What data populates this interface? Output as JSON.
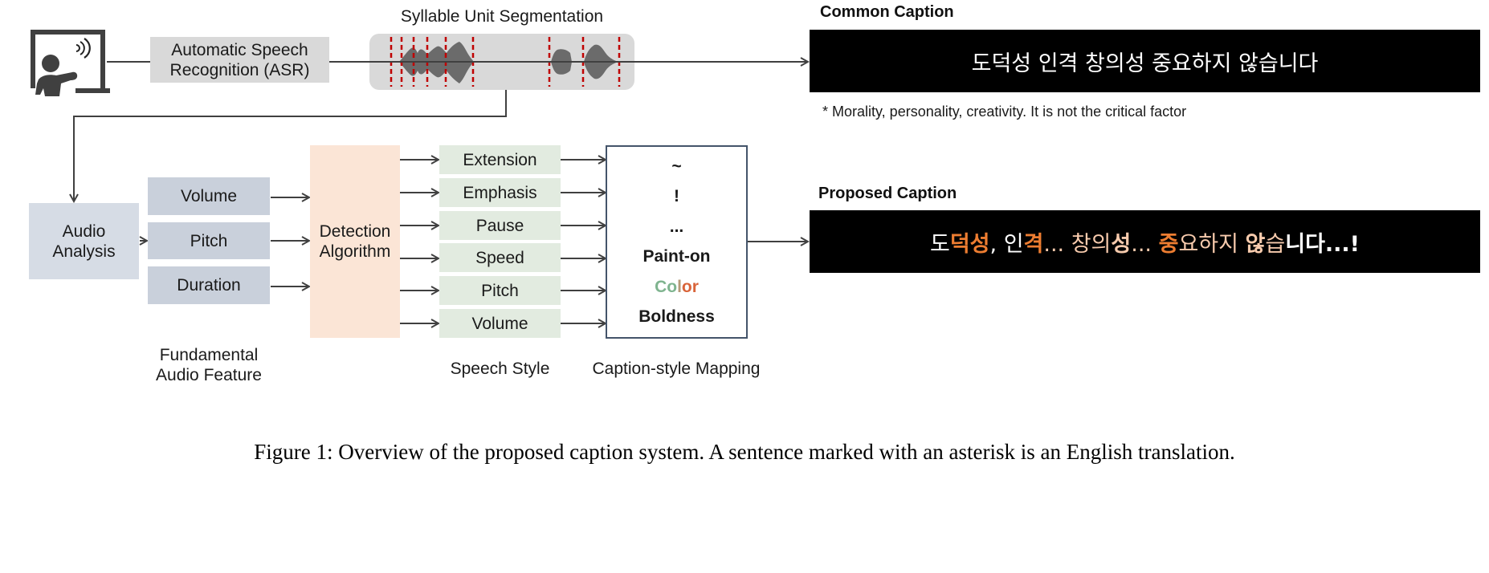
{
  "figure": {
    "caption": "Figure 1: Overview of the proposed caption system. A sentence marked with an asterisk is an English translation."
  },
  "speaker": {
    "icon": "teacher-presenting-speaking-icon"
  },
  "asr": {
    "label_line1": "Automatic Speech",
    "label_line2": "Recognition (ASR)"
  },
  "segmentation": {
    "title": "Syllable Unit Segmentation",
    "icon": "audio-waveform-icon",
    "marker_color": "#c00000"
  },
  "common_caption": {
    "title": "Common Caption",
    "text": "도덕성 인격 창의성 중요하지 않습니다",
    "translation": "* Morality, personality, creativity. It is not the critical factor"
  },
  "audio_analysis": {
    "label_line1": "Audio",
    "label_line2": "Analysis"
  },
  "fundamental_features": {
    "items": [
      "Volume",
      "Pitch",
      "Duration"
    ],
    "caption_line1": "Fundamental",
    "caption_line2": "Audio Feature"
  },
  "detection": {
    "label_line1": "Detection",
    "label_line2": "Algorithm"
  },
  "speech_style": {
    "items": [
      "Extension",
      "Emphasis",
      "Pause",
      "Speed",
      "Pitch",
      "Volume"
    ],
    "caption": "Speech Style"
  },
  "caption_style_mapping": {
    "items": [
      "~",
      "!",
      "...",
      "Paint-on",
      "Color",
      "Boldness"
    ],
    "color_word": {
      "parts": [
        "Co",
        "l",
        "or"
      ],
      "colors": [
        "#7fb48f",
        "#b69a78",
        "#d9643a"
      ]
    },
    "caption": "Caption-style Mapping"
  },
  "proposed_caption": {
    "title": "Proposed Caption",
    "segments": [
      {
        "text": "도",
        "style": "plain"
      },
      {
        "text": "덕성",
        "style": "orange-bold"
      },
      {
        "text": ", 인",
        "style": "plain"
      },
      {
        "text": "격",
        "style": "orange-bold"
      },
      {
        "text": "... 창의",
        "style": "peach"
      },
      {
        "text": "성",
        "style": "peach-bold"
      },
      {
        "text": "... ",
        "style": "peach"
      },
      {
        "text": "중",
        "style": "orange-bold"
      },
      {
        "text": "요하지 ",
        "style": "peach"
      },
      {
        "text": "않",
        "style": "peach-bold"
      },
      {
        "text": "습",
        "style": "peach"
      },
      {
        "text": "니다...!",
        "style": "white-bold"
      }
    ]
  },
  "colors": {
    "line": "#404040",
    "asr_box": "#d9d9d9",
    "analysis_box": "#d6dce5",
    "feature_box": "#c9d0db",
    "detection_box": "#fbe5d6",
    "style_box": "#e2ebe0",
    "mapping_border": "#44546a",
    "caption_bg": "#000000",
    "accent_orange": "#ed7d31",
    "accent_peach": "#f8cbad"
  }
}
